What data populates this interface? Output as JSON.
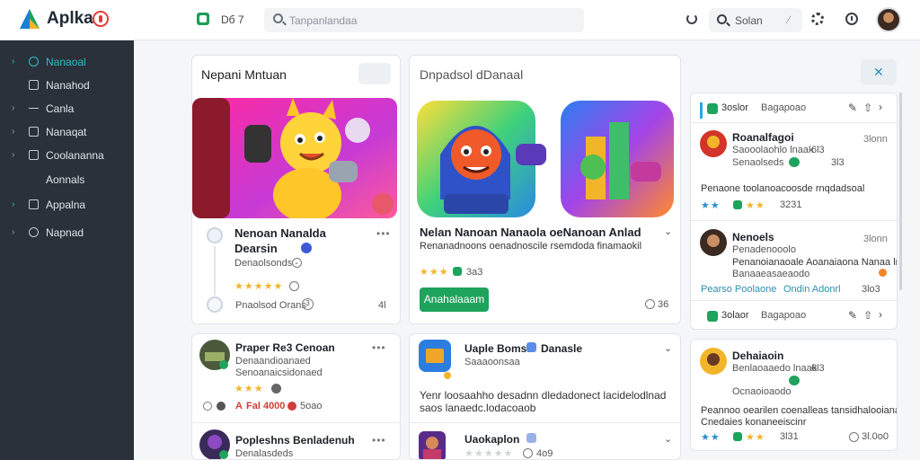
{
  "app": {
    "title": "Aplka"
  },
  "topbar": {
    "app_label": "Dб 7",
    "search_placeholder": "Tanpanlandaa",
    "search2_label": "Solan",
    "search2_sep": "∕"
  },
  "sidebar": {
    "items": [
      {
        "label": "Nanaoal",
        "active": true
      },
      {
        "label": "Nanahod",
        "active": false
      },
      {
        "label": "Canla",
        "active": false
      },
      {
        "label": "Nanaqat",
        "active": false
      },
      {
        "label": "Coolananna",
        "active": false
      },
      {
        "label": "Aonnals",
        "active": false
      },
      {
        "label": "Appalna",
        "active": false
      },
      {
        "label": "Napnad",
        "active": false
      }
    ]
  },
  "card1": {
    "title": "Nepani Mntuan",
    "app_name": "Nenoan Nanalda",
    "app_sub": "Dearsin",
    "meta": "Denaolsonds -",
    "stars": "★★★★★",
    "footer_label": "Pnaolsod Orans",
    "footer_num": "3",
    "footer_right": "4l"
  },
  "card2": {
    "title": "Dnpadsol dDanaal",
    "headline": "Nelan Nanoan Nanaola oeNanoan Anlad",
    "desc": "Renanadnoons oenadnoscile rsemdoda finamaokil",
    "stars": "★★★",
    "rating": "3a3",
    "button": "Anahalaaam",
    "count": "36"
  },
  "card3": {
    "title": "Praper Re3 Cenoan",
    "line1": "Denaandioanaed",
    "line2": "Senoanaicsidonaed",
    "stars": "★★★",
    "price_prefix": "A",
    "price": "Fal 4000",
    "price_tail": "5oao",
    "title2": "Popleshns Benladenuh",
    "line3": "Denalasdeds"
  },
  "card4": {
    "title": "Uaple Bomsh",
    "title_tail": "Danasle",
    "line1": "Saaaoonsaa",
    "desc1": "Yenr loosaahho desadnn dledadonect lacidelodlnad",
    "desc2": "sаos lanaedc.lodacoaob",
    "title2": "Uaokaplon",
    "stars2": "★★★★★",
    "price2": "4o9"
  },
  "panel1": {
    "tab": "3oslor",
    "tab2": "Bagapoao",
    "rows": [
      {
        "name": "Roanalfagoi",
        "sub1": "Saooolaohlo lnaak",
        "sub2": "Senaolseds",
        "num": "3lonn",
        "stat": "6l3",
        "stat2": "3l3",
        "desc": "Penaone toolanoacoosde rnqdadsoal",
        "rating": "3231"
      },
      {
        "name": "Nenoels",
        "sub1": "Penadenooolo",
        "sub2": "Banaaeasaeaodo",
        "num": "3lonn",
        "desc": "Penanoianaoale Aoanaiaona Nanaa lna",
        "link": "Pearso Poolaone",
        "link2": "Ondin Adonrl",
        "stat": "3lo3"
      }
    ],
    "foot_tab": "3olaor",
    "foot_tab2": "Bagapoao"
  },
  "panel2": {
    "name": "Dehaiaoin",
    "sub1": "Benlaoaaedo lnaak",
    "sub2": "Ocnaoioaodo",
    "stat": "6l3",
    "desc1": "Peannoo oearilen coenalleas tansidhalooianal",
    "desc2": "Cnedaies konaneeiscinr",
    "rating": "3l31",
    "num": "3l.0o0"
  },
  "colors": {
    "accent": "#29c0c8",
    "green": "#1ea35d",
    "star": "#f2b52a",
    "sidebar_bg": "#2b313a"
  }
}
